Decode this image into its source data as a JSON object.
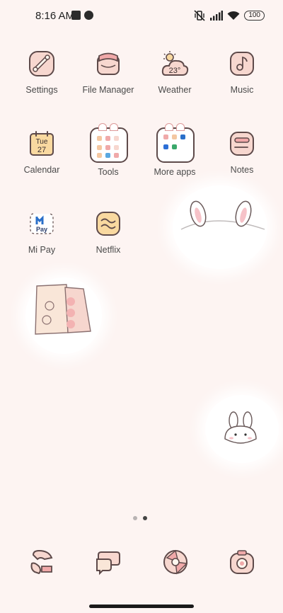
{
  "status_bar": {
    "time": "8:16 AM",
    "battery": "100"
  },
  "apps": [
    {
      "name": "settings",
      "label": "Settings",
      "icon": "settings-icon"
    },
    {
      "name": "file-manager",
      "label": "File Manager",
      "icon": "file-manager-icon"
    },
    {
      "name": "weather",
      "label": "Weather",
      "icon": "weather-icon",
      "temperature": "23°"
    },
    {
      "name": "music",
      "label": "Music",
      "icon": "music-icon"
    },
    {
      "name": "calendar",
      "label": "Calendar",
      "icon": "calendar-icon",
      "day": "Tue",
      "date": "27"
    },
    {
      "name": "notes",
      "label": "Notes",
      "icon": "notes-icon"
    },
    {
      "name": "mi-pay",
      "label": "Mi Pay",
      "icon": "mi-pay-icon",
      "icon_text": "Pay"
    },
    {
      "name": "netflix",
      "label": "Netflix",
      "icon": "netflix-icon"
    }
  ],
  "folders": [
    {
      "name": "tools",
      "label": "Tools"
    },
    {
      "name": "more-apps",
      "label": "More apps"
    }
  ],
  "page_indicator": {
    "pages": 2,
    "active": 2
  },
  "dock": [
    {
      "name": "phone",
      "icon": "phone-icon"
    },
    {
      "name": "messages",
      "icon": "messages-icon"
    },
    {
      "name": "browser",
      "icon": "browser-icon"
    },
    {
      "name": "camera",
      "icon": "camera-icon"
    }
  ],
  "colors": {
    "background": "#fdf4f2",
    "icon_fill": "#f7d7cf",
    "icon_stroke": "#5e4a4a",
    "accent_pink": "#f0a9a9"
  }
}
